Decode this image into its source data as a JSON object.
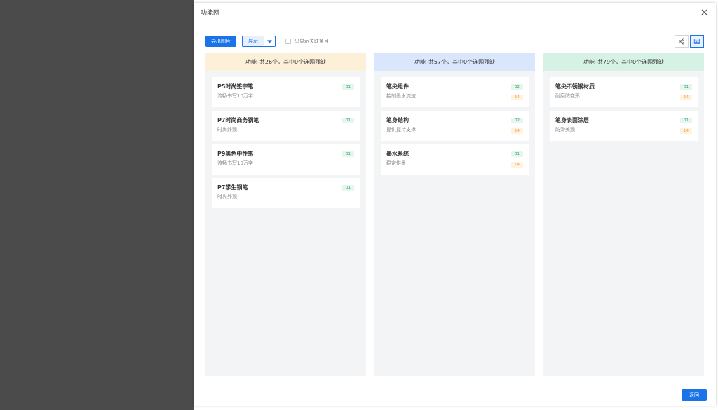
{
  "dialog": {
    "title": "功能网"
  },
  "toolbar": {
    "export_label": "导出图片",
    "display_label": "展示",
    "only_related_label": "只显示关联条目"
  },
  "columns": [
    {
      "header": "功能–共26个，其中0个连网残缺",
      "header_color": "#fdf0d9",
      "cards": [
        {
          "title": "P5时尚签字笔",
          "sub": "流畅书写10万字",
          "badges": [
            "01"
          ]
        },
        {
          "title": "P7时尚商务钢笔",
          "sub": "时尚外观",
          "badges": [
            "01"
          ]
        },
        {
          "title": "P9黑色中性笔",
          "sub": "流畅书写10万字",
          "badges": [
            "01"
          ]
        },
        {
          "title": "P7学生钢笔",
          "sub": "时尚外观",
          "badges": [
            "01"
          ]
        }
      ]
    },
    {
      "header": "功能–共57个，其中0个连网残缺",
      "header_color": "#d9e6fb",
      "cards": [
        {
          "title": "笔尖组件",
          "sub": "控制墨水流速",
          "badges": [
            "02",
            "14"
          ]
        },
        {
          "title": "笔身结构",
          "sub": "提供握持支撑",
          "badges": [
            "02",
            "14"
          ]
        },
        {
          "title": "墨水系统",
          "sub": "稳定供墨",
          "badges": [
            "01",
            "14"
          ]
        }
      ]
    },
    {
      "header": "功能–共79个，其中0个连网残缺",
      "header_color": "#d6f2e4",
      "cards": [
        {
          "title": "笔尖不锈钢材质",
          "sub": "耐磨防变形",
          "badges": [
            "01",
            "14"
          ]
        },
        {
          "title": "笔身表面涂层",
          "sub": "防滑美观",
          "badges": [
            "01",
            "14"
          ]
        }
      ]
    }
  ],
  "footer": {
    "back_label": "返回"
  },
  "colors": {
    "accent": "#1a73e8",
    "backdrop": "#4b4b4b",
    "badge_green": "#2da760",
    "badge_orange": "#f0a040"
  },
  "icons": {
    "close": "close-icon",
    "caret": "chevron-down-icon",
    "share": "share-icon",
    "table": "table-view-icon"
  }
}
